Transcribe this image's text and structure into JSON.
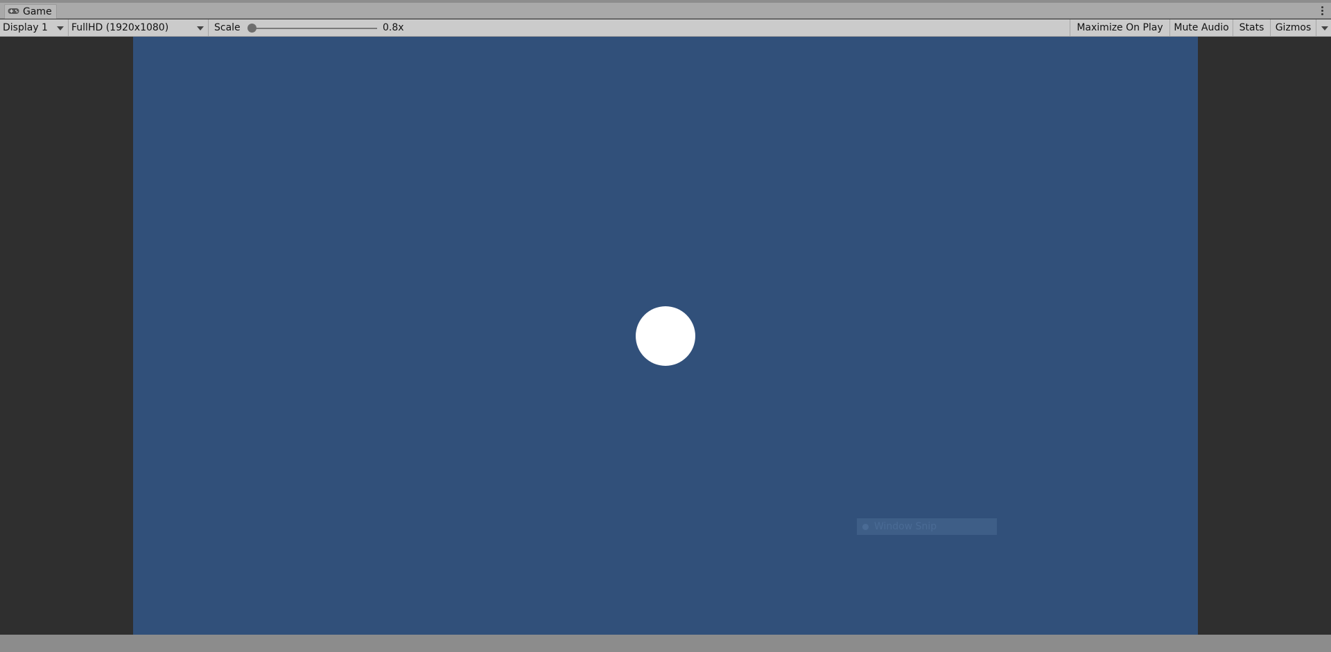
{
  "tab": {
    "title": "Game",
    "icon": "gamepad-icon"
  },
  "toolbar": {
    "display": "Display 1",
    "resolution": "FullHD (1920x1080)",
    "scale_label": "Scale",
    "scale_value": "0.8x",
    "maximize": "Maximize On Play",
    "mute": "Mute Audio",
    "stats": "Stats",
    "gizmos": "Gizmos"
  },
  "overlay": {
    "snip_label": "Window Snip"
  },
  "colors": {
    "game_background": "#31507a",
    "ball": "#ffffff",
    "letterbox": "#2f2f2f"
  }
}
